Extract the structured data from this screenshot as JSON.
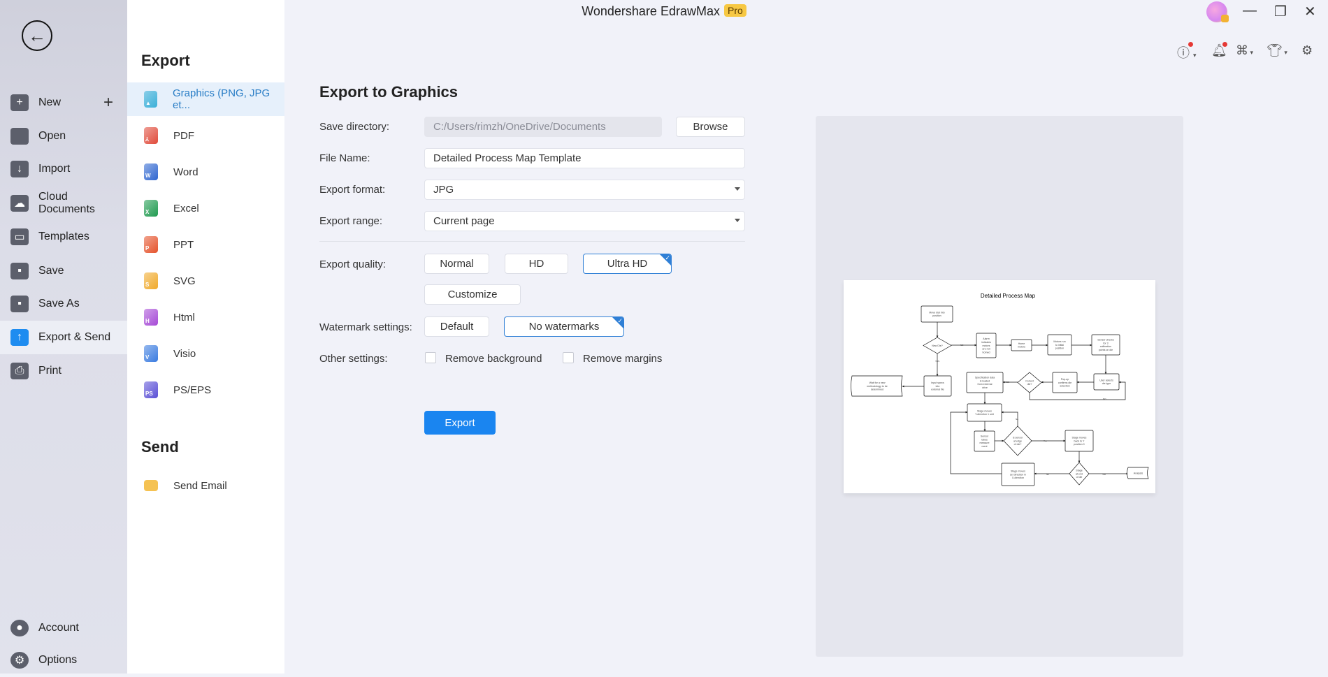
{
  "app": {
    "title": "Wondershare EdrawMax",
    "badge": "Pro"
  },
  "sidebar": {
    "items": [
      {
        "label": "New",
        "icon": "plus-square-icon",
        "glyph": "+"
      },
      {
        "label": "Open",
        "icon": "folder-icon",
        "glyph": ""
      },
      {
        "label": "Import",
        "icon": "import-icon",
        "glyph": "↓"
      },
      {
        "label": "Cloud Documents",
        "icon": "cloud-icon",
        "glyph": "☁"
      },
      {
        "label": "Templates",
        "icon": "templates-icon",
        "glyph": "▭"
      },
      {
        "label": "Save",
        "icon": "save-icon",
        "glyph": "▪"
      },
      {
        "label": "Save As",
        "icon": "save-as-icon",
        "glyph": "▪"
      },
      {
        "label": "Export & Send",
        "icon": "export-icon",
        "glyph": "↑"
      },
      {
        "label": "Print",
        "icon": "print-icon",
        "glyph": "⎙"
      }
    ],
    "bottom": [
      {
        "label": "Account",
        "icon": "account-icon"
      },
      {
        "label": "Options",
        "icon": "gear-icon"
      }
    ]
  },
  "panel": {
    "export_heading": "Export",
    "send_heading": "Send",
    "formats": [
      {
        "label": "Graphics (PNG, JPG et...",
        "letter": "▲",
        "color": "#3ab0d8"
      },
      {
        "label": "PDF",
        "letter": "⅄",
        "color": "#e04a3a"
      },
      {
        "label": "Word",
        "letter": "W",
        "color": "#2f66d0"
      },
      {
        "label": "Excel",
        "letter": "X",
        "color": "#1f9a4f"
      },
      {
        "label": "PPT",
        "letter": "P",
        "color": "#e5532c"
      },
      {
        "label": "SVG",
        "letter": "S",
        "color": "#f0a92a"
      },
      {
        "label": "Html",
        "letter": "H",
        "color": "#a64ad6"
      },
      {
        "label": "Visio",
        "letter": "V",
        "color": "#3a7be0"
      },
      {
        "label": "PS/EPS",
        "letter": "PS",
        "color": "#5a4fd6"
      }
    ],
    "send_items": [
      {
        "label": "Send Email",
        "color": "#f5c252"
      }
    ]
  },
  "main": {
    "title": "Export to Graphics",
    "save_directory": {
      "label": "Save directory:",
      "value": "C:/Users/rimzh/OneDrive/Documents",
      "button": "Browse"
    },
    "file_name": {
      "label": "File Name:",
      "value": "Detailed Process Map Template"
    },
    "export_format": {
      "label": "Export format:",
      "value": "JPG"
    },
    "export_range": {
      "label": "Export range:",
      "value": "Current page"
    },
    "export_quality": {
      "label": "Export quality:",
      "options": [
        "Normal",
        "HD",
        "Ultra HD"
      ],
      "selected": "Ultra HD",
      "customize": "Customize"
    },
    "watermark": {
      "label": "Watermark settings:",
      "options": [
        "Default",
        "No watermarks"
      ],
      "selected": "No watermarks"
    },
    "other": {
      "label": "Other settings:",
      "remove_background": {
        "label": "Remove background",
        "checked": false
      },
      "remove_margins": {
        "label": "Remove margins",
        "checked": false
      }
    },
    "export_button": "Export"
  },
  "preview": {
    "title": "Detailed Process Map",
    "nodes": [
      {
        "id": "a",
        "type": "rect",
        "lines": [
          "Move dial into",
          "position"
        ]
      },
      {
        "id": "b",
        "type": "diamond",
        "lines": [
          "New Die?"
        ]
      },
      {
        "id": "c",
        "type": "rect",
        "lines": [
          "Alarm",
          "indicates",
          "motors",
          "are not",
          "homed"
        ]
      },
      {
        "id": "d",
        "type": "rect",
        "lines": [
          "Home",
          "motors"
        ]
      },
      {
        "id": "e",
        "type": "rect",
        "lines": [
          "Motors run",
          "to initial",
          "position"
        ]
      },
      {
        "id": "f",
        "type": "rect",
        "lines": [
          "Sensor checks",
          "for 3",
          "calibration",
          "points on die"
        ]
      },
      {
        "id": "g",
        "type": "rect",
        "lines": [
          "User selects",
          "die type"
        ]
      },
      {
        "id": "h",
        "type": "rect",
        "lines": [
          "Pop-up",
          "confirms die",
          "selection"
        ]
      },
      {
        "id": "i",
        "type": "diamond",
        "lines": [
          "Correct",
          "die?"
        ]
      },
      {
        "id": "j",
        "type": "rect",
        "lines": [
          "Specification data",
          "is loaded",
          "from external",
          "drive"
        ]
      },
      {
        "id": "k",
        "type": "rect",
        "lines": [
          "Input specs",
          "into",
          "external file"
        ]
      },
      {
        "id": "l",
        "type": "tape",
        "lines": [
          "Wait for a new",
          "methodology to be",
          "determined"
        ]
      },
      {
        "id": "m",
        "type": "rect",
        "lines": [
          "Stage moves",
          "Y-direction 1 unit"
        ]
      },
      {
        "id": "n",
        "type": "rect",
        "lines": [
          "Sensor",
          "takes",
          "measure",
          "ment"
        ]
      },
      {
        "id": "o",
        "type": "diamond",
        "lines": [
          "Is sensor",
          "at edge",
          "of die?"
        ]
      },
      {
        "id": "p",
        "type": "rect",
        "lines": [
          "Stage moves",
          "back to Y",
          "position 0"
        ]
      },
      {
        "id": "q",
        "type": "diamond",
        "lines": [
          "Stage",
          "at end",
          "of die"
        ]
      },
      {
        "id": "r",
        "type": "rect",
        "lines": [
          "Stage moves",
          "set direction in",
          "X-direction"
        ]
      },
      {
        "id": "s",
        "type": "tape",
        "lines": [
          "Analysis"
        ]
      }
    ],
    "edge_labels": [
      "NO",
      "YES",
      "YES",
      "NO",
      "No",
      "Yes",
      "No",
      "Yes"
    ]
  },
  "toolbar": {
    "icons": [
      "help-icon",
      "bell-icon",
      "apps-icon",
      "theme-shirt-icon",
      "settings-icon"
    ]
  }
}
